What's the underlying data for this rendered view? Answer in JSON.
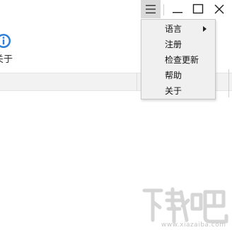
{
  "menu": {
    "items": [
      {
        "label": "语言",
        "has_submenu": true
      },
      {
        "label": "注册",
        "has_submenu": false
      },
      {
        "label": "检查更新",
        "has_submenu": false
      },
      {
        "label": "帮助",
        "has_submenu": false
      },
      {
        "label": "关于",
        "has_submenu": false
      }
    ]
  },
  "about": {
    "label": "关于",
    "icon": "info-icon"
  },
  "window_controls": {
    "menu_icon": "hamburger-icon",
    "minimize_icon": "minimize-icon",
    "maximize_icon": "maximize-icon",
    "close_icon": "close-icon"
  },
  "watermark": {
    "text": "www.xiazaiba.com"
  },
  "colors": {
    "info_blue": "#2f7fd6",
    "menu_bg": "#f0f0f0"
  }
}
